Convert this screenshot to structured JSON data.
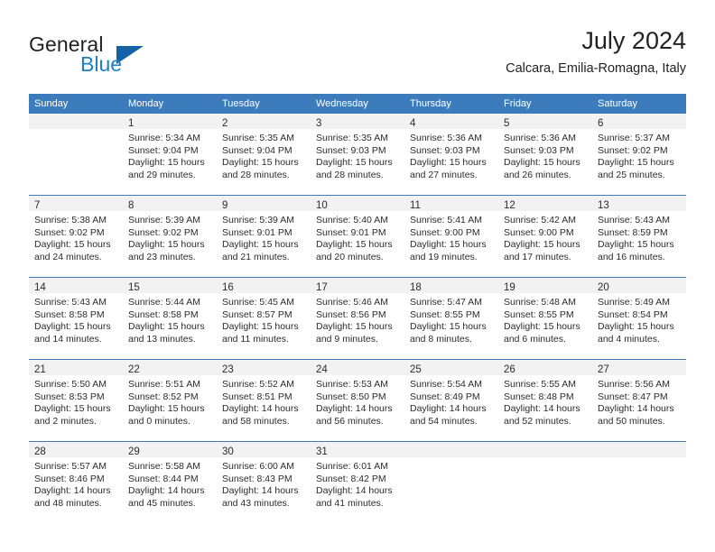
{
  "brand": {
    "word1": "General",
    "word2": "Blue",
    "accent_color": "#1362a5",
    "blue_text_color": "#1f7fc4"
  },
  "header": {
    "title": "July 2024",
    "subtitle": "Calcara, Emilia-Romagna, Italy"
  },
  "calendar": {
    "header_bg": "#3d7cbc",
    "daynum_band_bg": "#f2f2f2",
    "weekday_headers": [
      "Sunday",
      "Monday",
      "Tuesday",
      "Wednesday",
      "Thursday",
      "Friday",
      "Saturday"
    ],
    "weeks": [
      [
        {
          "day": "",
          "lines": []
        },
        {
          "day": "1",
          "lines": [
            "Sunrise: 5:34 AM",
            "Sunset: 9:04 PM",
            "Daylight: 15 hours",
            "and 29 minutes."
          ]
        },
        {
          "day": "2",
          "lines": [
            "Sunrise: 5:35 AM",
            "Sunset: 9:04 PM",
            "Daylight: 15 hours",
            "and 28 minutes."
          ]
        },
        {
          "day": "3",
          "lines": [
            "Sunrise: 5:35 AM",
            "Sunset: 9:03 PM",
            "Daylight: 15 hours",
            "and 28 minutes."
          ]
        },
        {
          "day": "4",
          "lines": [
            "Sunrise: 5:36 AM",
            "Sunset: 9:03 PM",
            "Daylight: 15 hours",
            "and 27 minutes."
          ]
        },
        {
          "day": "5",
          "lines": [
            "Sunrise: 5:36 AM",
            "Sunset: 9:03 PM",
            "Daylight: 15 hours",
            "and 26 minutes."
          ]
        },
        {
          "day": "6",
          "lines": [
            "Sunrise: 5:37 AM",
            "Sunset: 9:02 PM",
            "Daylight: 15 hours",
            "and 25 minutes."
          ]
        }
      ],
      [
        {
          "day": "7",
          "lines": [
            "Sunrise: 5:38 AM",
            "Sunset: 9:02 PM",
            "Daylight: 15 hours",
            "and 24 minutes."
          ]
        },
        {
          "day": "8",
          "lines": [
            "Sunrise: 5:39 AM",
            "Sunset: 9:02 PM",
            "Daylight: 15 hours",
            "and 23 minutes."
          ]
        },
        {
          "day": "9",
          "lines": [
            "Sunrise: 5:39 AM",
            "Sunset: 9:01 PM",
            "Daylight: 15 hours",
            "and 21 minutes."
          ]
        },
        {
          "day": "10",
          "lines": [
            "Sunrise: 5:40 AM",
            "Sunset: 9:01 PM",
            "Daylight: 15 hours",
            "and 20 minutes."
          ]
        },
        {
          "day": "11",
          "lines": [
            "Sunrise: 5:41 AM",
            "Sunset: 9:00 PM",
            "Daylight: 15 hours",
            "and 19 minutes."
          ]
        },
        {
          "day": "12",
          "lines": [
            "Sunrise: 5:42 AM",
            "Sunset: 9:00 PM",
            "Daylight: 15 hours",
            "and 17 minutes."
          ]
        },
        {
          "day": "13",
          "lines": [
            "Sunrise: 5:43 AM",
            "Sunset: 8:59 PM",
            "Daylight: 15 hours",
            "and 16 minutes."
          ]
        }
      ],
      [
        {
          "day": "14",
          "lines": [
            "Sunrise: 5:43 AM",
            "Sunset: 8:58 PM",
            "Daylight: 15 hours",
            "and 14 minutes."
          ]
        },
        {
          "day": "15",
          "lines": [
            "Sunrise: 5:44 AM",
            "Sunset: 8:58 PM",
            "Daylight: 15 hours",
            "and 13 minutes."
          ]
        },
        {
          "day": "16",
          "lines": [
            "Sunrise: 5:45 AM",
            "Sunset: 8:57 PM",
            "Daylight: 15 hours",
            "and 11 minutes."
          ]
        },
        {
          "day": "17",
          "lines": [
            "Sunrise: 5:46 AM",
            "Sunset: 8:56 PM",
            "Daylight: 15 hours",
            "and 9 minutes."
          ]
        },
        {
          "day": "18",
          "lines": [
            "Sunrise: 5:47 AM",
            "Sunset: 8:55 PM",
            "Daylight: 15 hours",
            "and 8 minutes."
          ]
        },
        {
          "day": "19",
          "lines": [
            "Sunrise: 5:48 AM",
            "Sunset: 8:55 PM",
            "Daylight: 15 hours",
            "and 6 minutes."
          ]
        },
        {
          "day": "20",
          "lines": [
            "Sunrise: 5:49 AM",
            "Sunset: 8:54 PM",
            "Daylight: 15 hours",
            "and 4 minutes."
          ]
        }
      ],
      [
        {
          "day": "21",
          "lines": [
            "Sunrise: 5:50 AM",
            "Sunset: 8:53 PM",
            "Daylight: 15 hours",
            "and 2 minutes."
          ]
        },
        {
          "day": "22",
          "lines": [
            "Sunrise: 5:51 AM",
            "Sunset: 8:52 PM",
            "Daylight: 15 hours",
            "and 0 minutes."
          ]
        },
        {
          "day": "23",
          "lines": [
            "Sunrise: 5:52 AM",
            "Sunset: 8:51 PM",
            "Daylight: 14 hours",
            "and 58 minutes."
          ]
        },
        {
          "day": "24",
          "lines": [
            "Sunrise: 5:53 AM",
            "Sunset: 8:50 PM",
            "Daylight: 14 hours",
            "and 56 minutes."
          ]
        },
        {
          "day": "25",
          "lines": [
            "Sunrise: 5:54 AM",
            "Sunset: 8:49 PM",
            "Daylight: 14 hours",
            "and 54 minutes."
          ]
        },
        {
          "day": "26",
          "lines": [
            "Sunrise: 5:55 AM",
            "Sunset: 8:48 PM",
            "Daylight: 14 hours",
            "and 52 minutes."
          ]
        },
        {
          "day": "27",
          "lines": [
            "Sunrise: 5:56 AM",
            "Sunset: 8:47 PM",
            "Daylight: 14 hours",
            "and 50 minutes."
          ]
        }
      ],
      [
        {
          "day": "28",
          "lines": [
            "Sunrise: 5:57 AM",
            "Sunset: 8:46 PM",
            "Daylight: 14 hours",
            "and 48 minutes."
          ]
        },
        {
          "day": "29",
          "lines": [
            "Sunrise: 5:58 AM",
            "Sunset: 8:44 PM",
            "Daylight: 14 hours",
            "and 45 minutes."
          ]
        },
        {
          "day": "30",
          "lines": [
            "Sunrise: 6:00 AM",
            "Sunset: 8:43 PM",
            "Daylight: 14 hours",
            "and 43 minutes."
          ]
        },
        {
          "day": "31",
          "lines": [
            "Sunrise: 6:01 AM",
            "Sunset: 8:42 PM",
            "Daylight: 14 hours",
            "and 41 minutes."
          ]
        },
        {
          "day": "",
          "lines": []
        },
        {
          "day": "",
          "lines": []
        },
        {
          "day": "",
          "lines": []
        }
      ]
    ]
  }
}
